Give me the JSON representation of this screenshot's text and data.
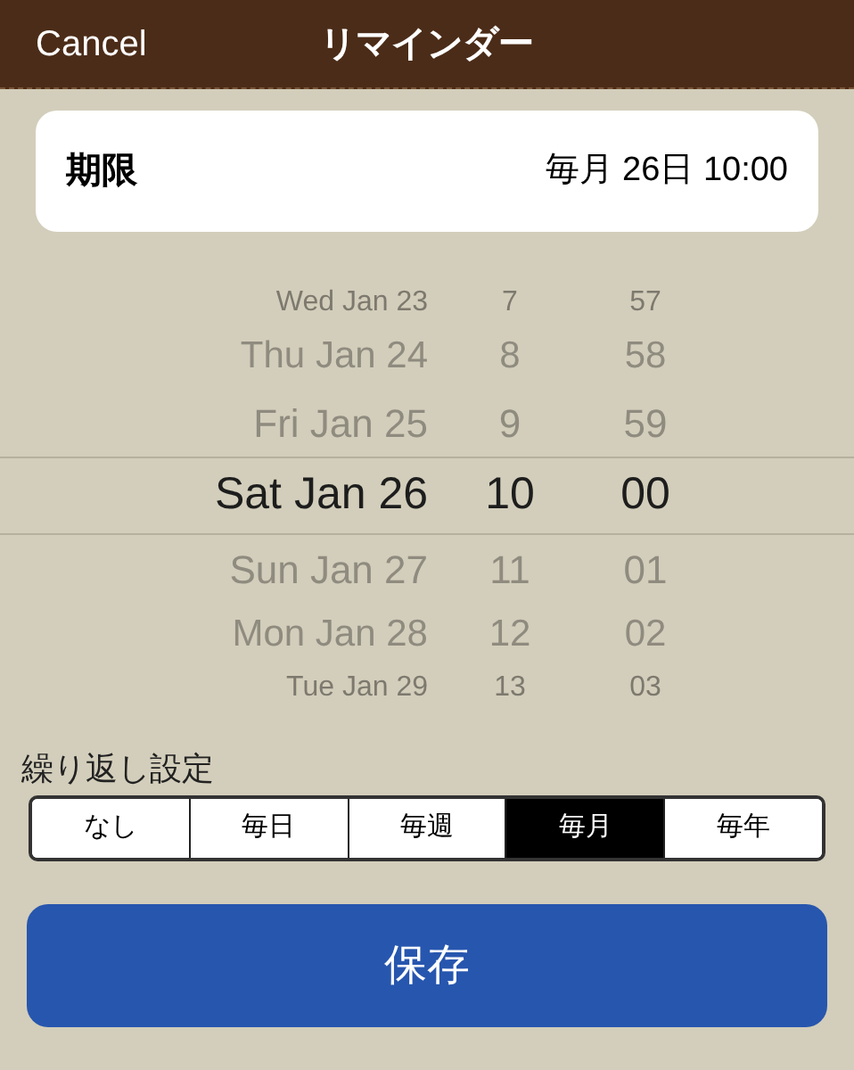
{
  "nav_bar": {
    "cancel": "Cancel",
    "title": "リマインダー"
  },
  "due": {
    "label": "期限",
    "value": "毎月 26日 10:00"
  },
  "picker": {
    "rows": [
      {
        "date": "Wed Jan 23",
        "hour": "7",
        "minute": "57",
        "selected": false
      },
      {
        "date": "Thu Jan 24",
        "hour": "8",
        "minute": "58",
        "selected": false
      },
      {
        "date": "Fri Jan 25",
        "hour": "9",
        "minute": "59",
        "selected": false
      },
      {
        "date": "Sat Jan 26",
        "hour": "10",
        "minute": "00",
        "selected": true
      },
      {
        "date": "Sun Jan 27",
        "hour": "11",
        "minute": "01",
        "selected": false
      },
      {
        "date": "Mon Jan 28",
        "hour": "12",
        "minute": "02",
        "selected": false
      },
      {
        "date": "Tue Jan 29",
        "hour": "13",
        "minute": "03",
        "selected": false
      }
    ]
  },
  "repeat": {
    "label": "繰り返し設定",
    "options": [
      {
        "label": "なし",
        "selected": false
      },
      {
        "label": "毎日",
        "selected": false
      },
      {
        "label": "毎週",
        "selected": false
      },
      {
        "label": "毎月",
        "selected": true
      },
      {
        "label": "毎年",
        "selected": false
      }
    ]
  },
  "save_button": "保存"
}
